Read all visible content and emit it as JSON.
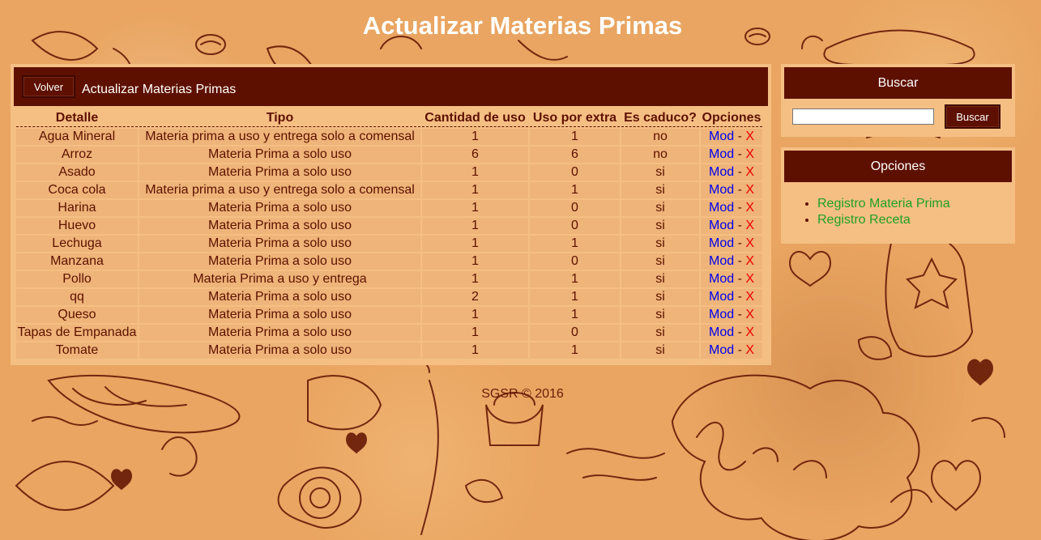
{
  "page": {
    "title": "Actualizar Materias Primas"
  },
  "main": {
    "back_label": "Volver",
    "header_title": "Actualizar Materias Primas",
    "columns": [
      "Detalle",
      "Tipo",
      "Cantidad de uso",
      "Uso por extra",
      "Es caduco?",
      "Opciones"
    ],
    "rows": [
      {
        "detalle": "Agua Mineral",
        "tipo": "Materia prima a uso y entrega solo a comensal",
        "cantidad": "1",
        "extra": "1",
        "caduco": "no"
      },
      {
        "detalle": "Arroz",
        "tipo": "Materia Prima a solo uso",
        "cantidad": "6",
        "extra": "6",
        "caduco": "no"
      },
      {
        "detalle": "Asado",
        "tipo": "Materia Prima a solo uso",
        "cantidad": "1",
        "extra": "0",
        "caduco": "si"
      },
      {
        "detalle": "Coca cola",
        "tipo": "Materia prima a uso y entrega solo a comensal",
        "cantidad": "1",
        "extra": "1",
        "caduco": "si"
      },
      {
        "detalle": "Harina",
        "tipo": "Materia Prima a solo uso",
        "cantidad": "1",
        "extra": "0",
        "caduco": "si"
      },
      {
        "detalle": "Huevo",
        "tipo": "Materia Prima a solo uso",
        "cantidad": "1",
        "extra": "0",
        "caduco": "si"
      },
      {
        "detalle": "Lechuga",
        "tipo": "Materia Prima a solo uso",
        "cantidad": "1",
        "extra": "1",
        "caduco": "si"
      },
      {
        "detalle": "Manzana",
        "tipo": "Materia Prima a solo uso",
        "cantidad": "1",
        "extra": "0",
        "caduco": "si"
      },
      {
        "detalle": "Pollo",
        "tipo": "Materia Prima a uso y entrega",
        "cantidad": "1",
        "extra": "1",
        "caduco": "si"
      },
      {
        "detalle": "qq",
        "tipo": "Materia Prima a solo uso",
        "cantidad": "2",
        "extra": "1",
        "caduco": "si"
      },
      {
        "detalle": "Queso",
        "tipo": "Materia Prima a solo uso",
        "cantidad": "1",
        "extra": "1",
        "caduco": "si"
      },
      {
        "detalle": "Tapas de Empanada",
        "tipo": "Materia Prima a solo uso",
        "cantidad": "1",
        "extra": "0",
        "caduco": "si"
      },
      {
        "detalle": "Tomate",
        "tipo": "Materia Prima a solo uso",
        "cantidad": "1",
        "extra": "1",
        "caduco": "si"
      }
    ],
    "mod_label": "Mod",
    "separator": "-",
    "delete_label": "X"
  },
  "search": {
    "header": "Buscar",
    "input_value": "",
    "button_label": "Buscar"
  },
  "options": {
    "header": "Opciones",
    "items": [
      "Registro Materia Prima",
      "Registro Receta"
    ]
  },
  "footer": {
    "text": "SGSR © 2016"
  },
  "colors": {
    "background": "#e9a561",
    "panel": "#f5bf84",
    "header_bar": "#5e1000",
    "text_dark": "#5e1000",
    "mod_link": "#0000ee",
    "delete_link": "#ee0000",
    "option_link": "#22a022"
  }
}
